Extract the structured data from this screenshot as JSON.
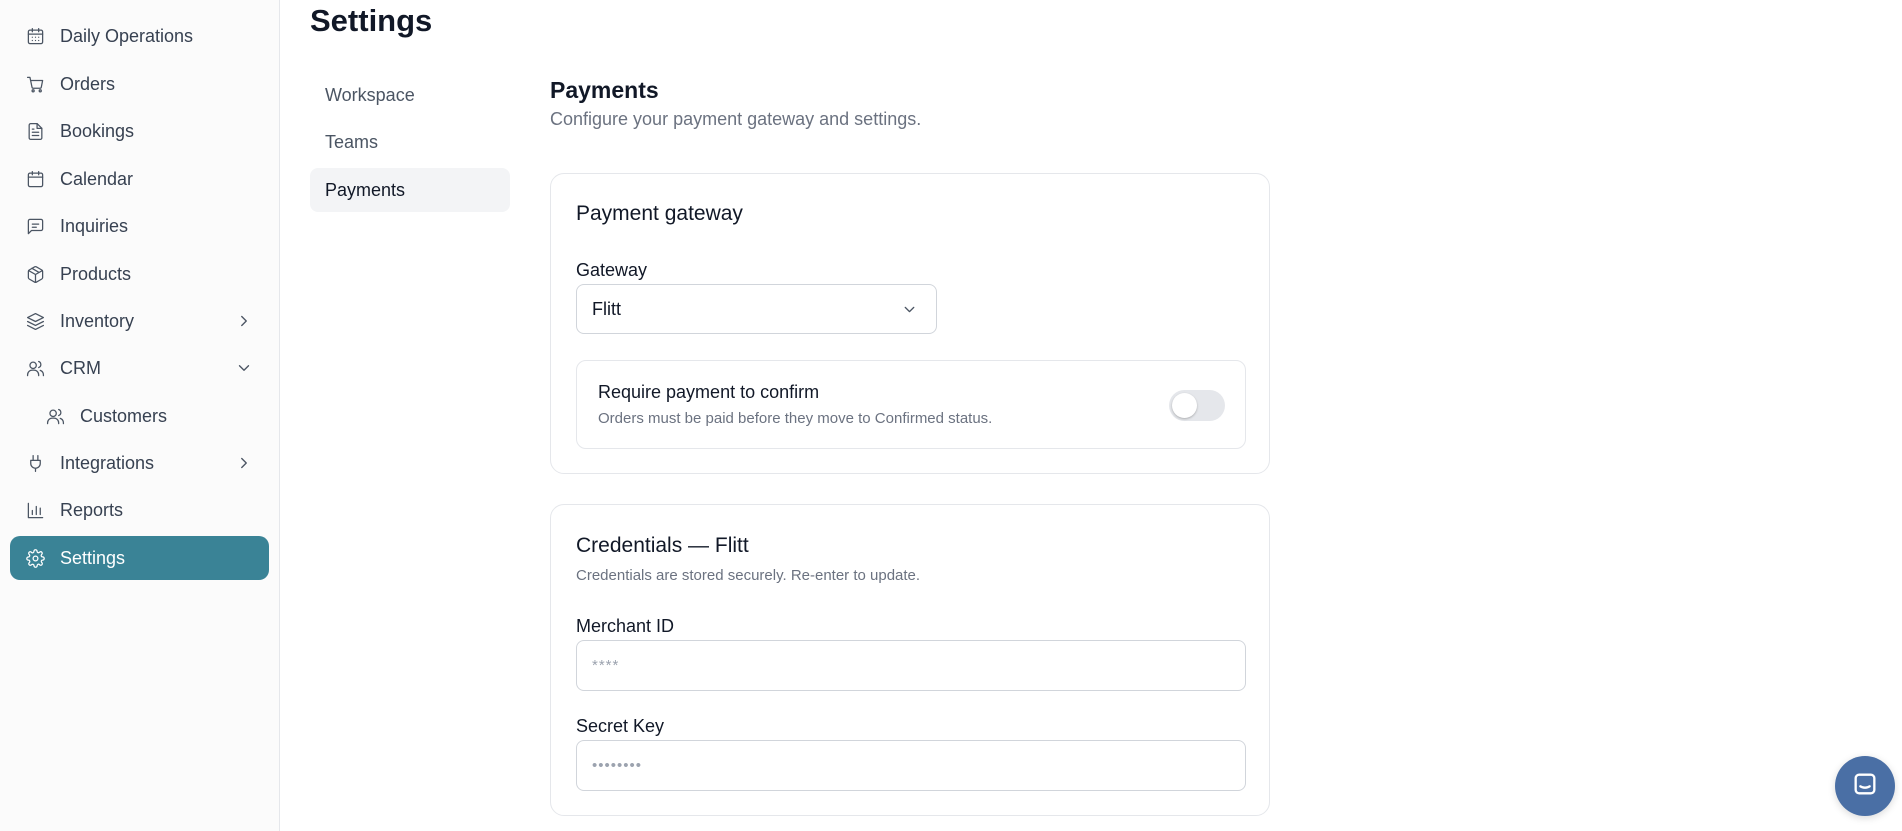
{
  "sidebar": {
    "items": [
      {
        "label": "Daily Operations",
        "icon": "calendar-grid-icon"
      },
      {
        "label": "Orders",
        "icon": "cart-icon"
      },
      {
        "label": "Bookings",
        "icon": "document-icon"
      },
      {
        "label": "Calendar",
        "icon": "calendar-icon"
      },
      {
        "label": "Inquiries",
        "icon": "message-icon"
      },
      {
        "label": "Products",
        "icon": "box-icon"
      },
      {
        "label": "Inventory",
        "icon": "layers-icon"
      },
      {
        "label": "CRM",
        "icon": "users-icon"
      },
      {
        "label": "Customers",
        "icon": "users-icon"
      },
      {
        "label": "Integrations",
        "icon": "plug-icon"
      },
      {
        "label": "Reports",
        "icon": "bar-chart-icon"
      },
      {
        "label": "Settings",
        "icon": "gear-icon"
      }
    ],
    "active_color": "#3a8396"
  },
  "page": {
    "title": "Settings"
  },
  "settings_nav": {
    "items": [
      "Workspace",
      "Teams",
      "Payments"
    ],
    "active": "Payments"
  },
  "payments": {
    "title": "Payments",
    "description": "Configure your payment gateway and settings.",
    "gateway_card": {
      "title": "Payment gateway",
      "gateway_label": "Gateway",
      "gateway_value": "Flitt",
      "require_payment": {
        "title": "Require payment to confirm",
        "description": "Orders must be paid before they move to Confirmed status.",
        "enabled": false
      }
    },
    "credentials_card": {
      "title": "Credentials — Flitt",
      "description": "Credentials are stored securely. Re-enter to update.",
      "merchant_label": "Merchant ID",
      "merchant_placeholder": "****",
      "secret_label": "Secret Key",
      "secret_placeholder": "••••••••"
    }
  },
  "chat": {
    "icon": "chat-icon"
  }
}
